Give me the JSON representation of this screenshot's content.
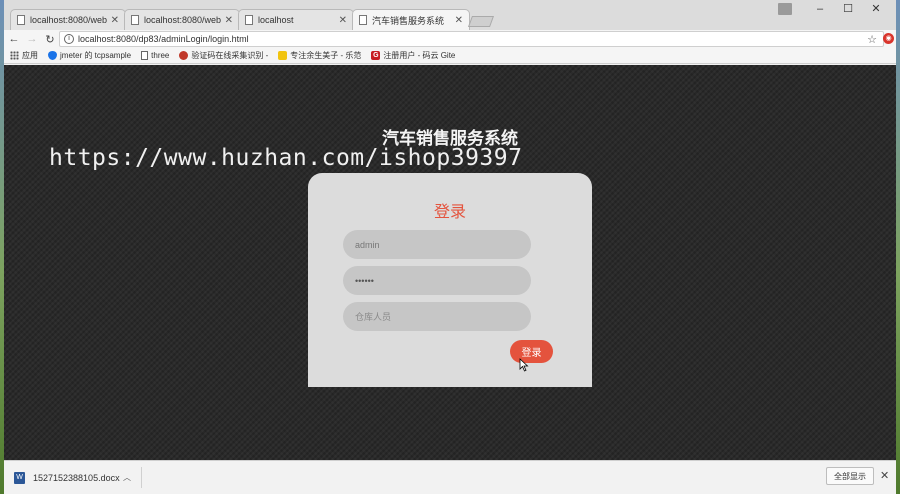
{
  "tabs": [
    {
      "title": "localhost:8080/webtoo",
      "active": false
    },
    {
      "title": "localhost:8080/webtoo",
      "active": false
    },
    {
      "title": "localhost",
      "active": false
    },
    {
      "title": "汽车销售服务系统",
      "active": true
    }
  ],
  "toolbar": {
    "url": "localhost:8080/dp83/adminLogin/login.html"
  },
  "bookmarks": [
    {
      "label": "应用",
      "icon": "apps-icon"
    },
    {
      "label": "jmeter 的 tcpsample",
      "icon": "shield-icon",
      "color": "#1a73e8"
    },
    {
      "label": "three",
      "icon": "file-icon"
    },
    {
      "label": "验证码在线采集识别 -",
      "icon": "bookmark-icon",
      "color": "#c0392b"
    },
    {
      "label": "专注余生美子 - 乐范",
      "icon": "bookmark-icon",
      "color": "#f1c40f"
    },
    {
      "label": "注册用户 - 码云 Gite",
      "icon": "gitee-icon",
      "color": "#c71d23"
    }
  ],
  "page": {
    "system_title": "汽车销售服务系统",
    "watermark": "https://www.huzhan.com/ishop39397",
    "login": {
      "heading": "登录",
      "username_value": "admin",
      "password_value": "••••••",
      "role_placeholder": "仓库人员",
      "button_label": "登录"
    }
  },
  "download_bar": {
    "file_name": "1527152388105.docx",
    "show_all_label": "全部显示"
  },
  "colors": {
    "accent": "#e4533d",
    "page_background": "#2b2b2b",
    "card_background": "#dcdcdc"
  }
}
